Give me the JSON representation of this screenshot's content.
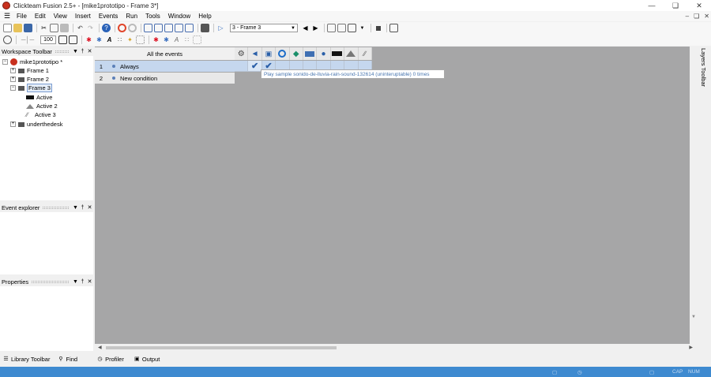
{
  "window": {
    "title": "Clickteam Fusion 2.5+ - [mike1prototipo - Frame 3*]"
  },
  "menu": [
    "File",
    "Edit",
    "View",
    "Insert",
    "Events",
    "Run",
    "Tools",
    "Window",
    "Help"
  ],
  "toolbar": {
    "frame_select": "3 - Frame 3",
    "zoom": "100"
  },
  "workspace": {
    "title": "Workspace Toolbar",
    "project": "mike1prototipo *",
    "frames": [
      "Frame 1",
      "Frame 2",
      "Frame 3"
    ],
    "frame3_children": [
      "Active",
      "Active 2",
      "Active 3"
    ],
    "extra": "underthedesk"
  },
  "event_explorer": {
    "title": "Event explorer"
  },
  "properties": {
    "title": "Properties"
  },
  "editor": {
    "header": "All the events",
    "events": [
      {
        "num": "1",
        "text": "Always"
      },
      {
        "num": "2",
        "text": "New condition"
      }
    ],
    "tooltip": "Play sample sonido-de-lluvia-rain-sound-132614 (uninteruptable) 0 times"
  },
  "layers_toolbar": "Layers Toolbar",
  "bottom_tabs": [
    "Library Toolbar",
    "Find",
    "Profiler",
    "Output"
  ],
  "status": [
    "CAP",
    "NUM"
  ],
  "colors": {
    "editor_bg": "#a6a6a7",
    "status_bar": "#3e8ad0",
    "selected_row": "#c5d7ee"
  },
  "icons": {
    "object_columns": [
      "special-conditions-icon",
      "sound-icon",
      "storyboard-icon",
      "timer-icon",
      "create-object-icon",
      "keyboard-mouse-icon",
      "player-icon",
      "active-icon",
      "active-2-icon",
      "active-3-icon"
    ]
  }
}
